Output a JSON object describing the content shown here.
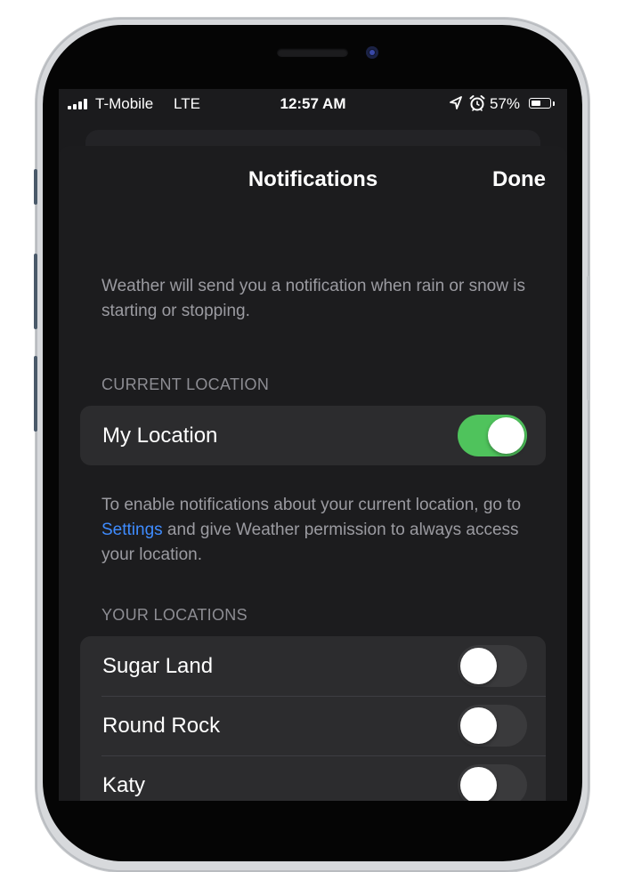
{
  "status_bar": {
    "carrier": "T-Mobile",
    "network": "LTE",
    "time": "12:57 AM",
    "battery_percent": "57%",
    "battery_level": 0.57,
    "icons": [
      "signal-bars-icon",
      "location-arrow-icon",
      "alarm-icon",
      "battery-icon"
    ]
  },
  "nav": {
    "title": "Notifications",
    "done_label": "Done"
  },
  "intro_text": "Weather will send you a notification when rain or snow is starting or stopping.",
  "current_location": {
    "header": "CURRENT LOCATION",
    "row": {
      "label": "My Location",
      "enabled": true
    }
  },
  "permission_note": {
    "before_link": "To enable notifications about your current location, go to ",
    "link_text": "Settings",
    "after_link": " and give Weather permission to always access your location."
  },
  "your_locations": {
    "header": "YOUR LOCATIONS",
    "rows": [
      {
        "label": "Sugar Land",
        "enabled": false
      },
      {
        "label": "Round Rock",
        "enabled": false
      },
      {
        "label": "Katy",
        "enabled": false
      }
    ]
  },
  "colors": {
    "toggle_on": "#4fc35c",
    "link": "#3f8cff",
    "background": "#1c1c1e"
  }
}
